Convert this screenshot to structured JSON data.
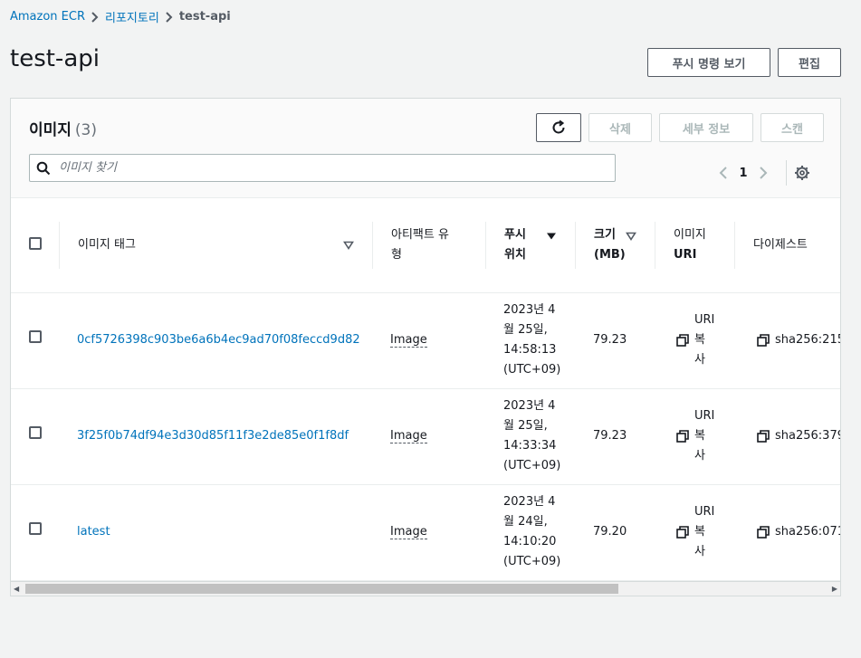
{
  "breadcrumb": {
    "root": "Amazon ECR",
    "repos": "리포지토리",
    "current": "test-api"
  },
  "page": {
    "title": "test-api"
  },
  "actions": {
    "push_commands": "푸시 명령 보기",
    "edit": "편집"
  },
  "images_panel": {
    "title": "이미지",
    "count": "(3)",
    "delete": "삭제",
    "details": "세부 정보",
    "scan": "스캔",
    "search_placeholder": "이미지 찾기",
    "page": "1"
  },
  "table": {
    "headers": {
      "tag": "이미지 태그",
      "artifact_1": "아티팩트 유",
      "artifact_2": "형",
      "pushed_1": "푸시",
      "pushed_2": "위치",
      "size_1": "크기",
      "size_2": "(MB)",
      "uri_1": "이미지",
      "uri_2": "URI",
      "digest": "다이제스트"
    },
    "rows": [
      {
        "tag": "0cf5726398c903be6a6b4ec9ad70f08feccd9d82",
        "artifact": "Image",
        "pushed": [
          "2023년 4",
          "월 25일,",
          "14:58:13",
          "(UTC+09)"
        ],
        "size": "79.23",
        "uri": [
          "URI",
          "복",
          "사"
        ],
        "digest": "sha256:215"
      },
      {
        "tag": "3f25f0b74df94e3d30d85f11f3e2de85e0f1f8df",
        "artifact": "Image",
        "pushed": [
          "2023년 4",
          "월 25일,",
          "14:33:34",
          "(UTC+09)"
        ],
        "size": "79.23",
        "uri": [
          "URI",
          "복",
          "사"
        ],
        "digest": "sha256:379"
      },
      {
        "tag": "latest",
        "artifact": "Image",
        "pushed": [
          "2023년 4",
          "월 24일,",
          "14:10:20",
          "(UTC+09)"
        ],
        "size": "79.20",
        "uri": [
          "URI",
          "복",
          "사"
        ],
        "digest": "sha256:071"
      }
    ]
  }
}
